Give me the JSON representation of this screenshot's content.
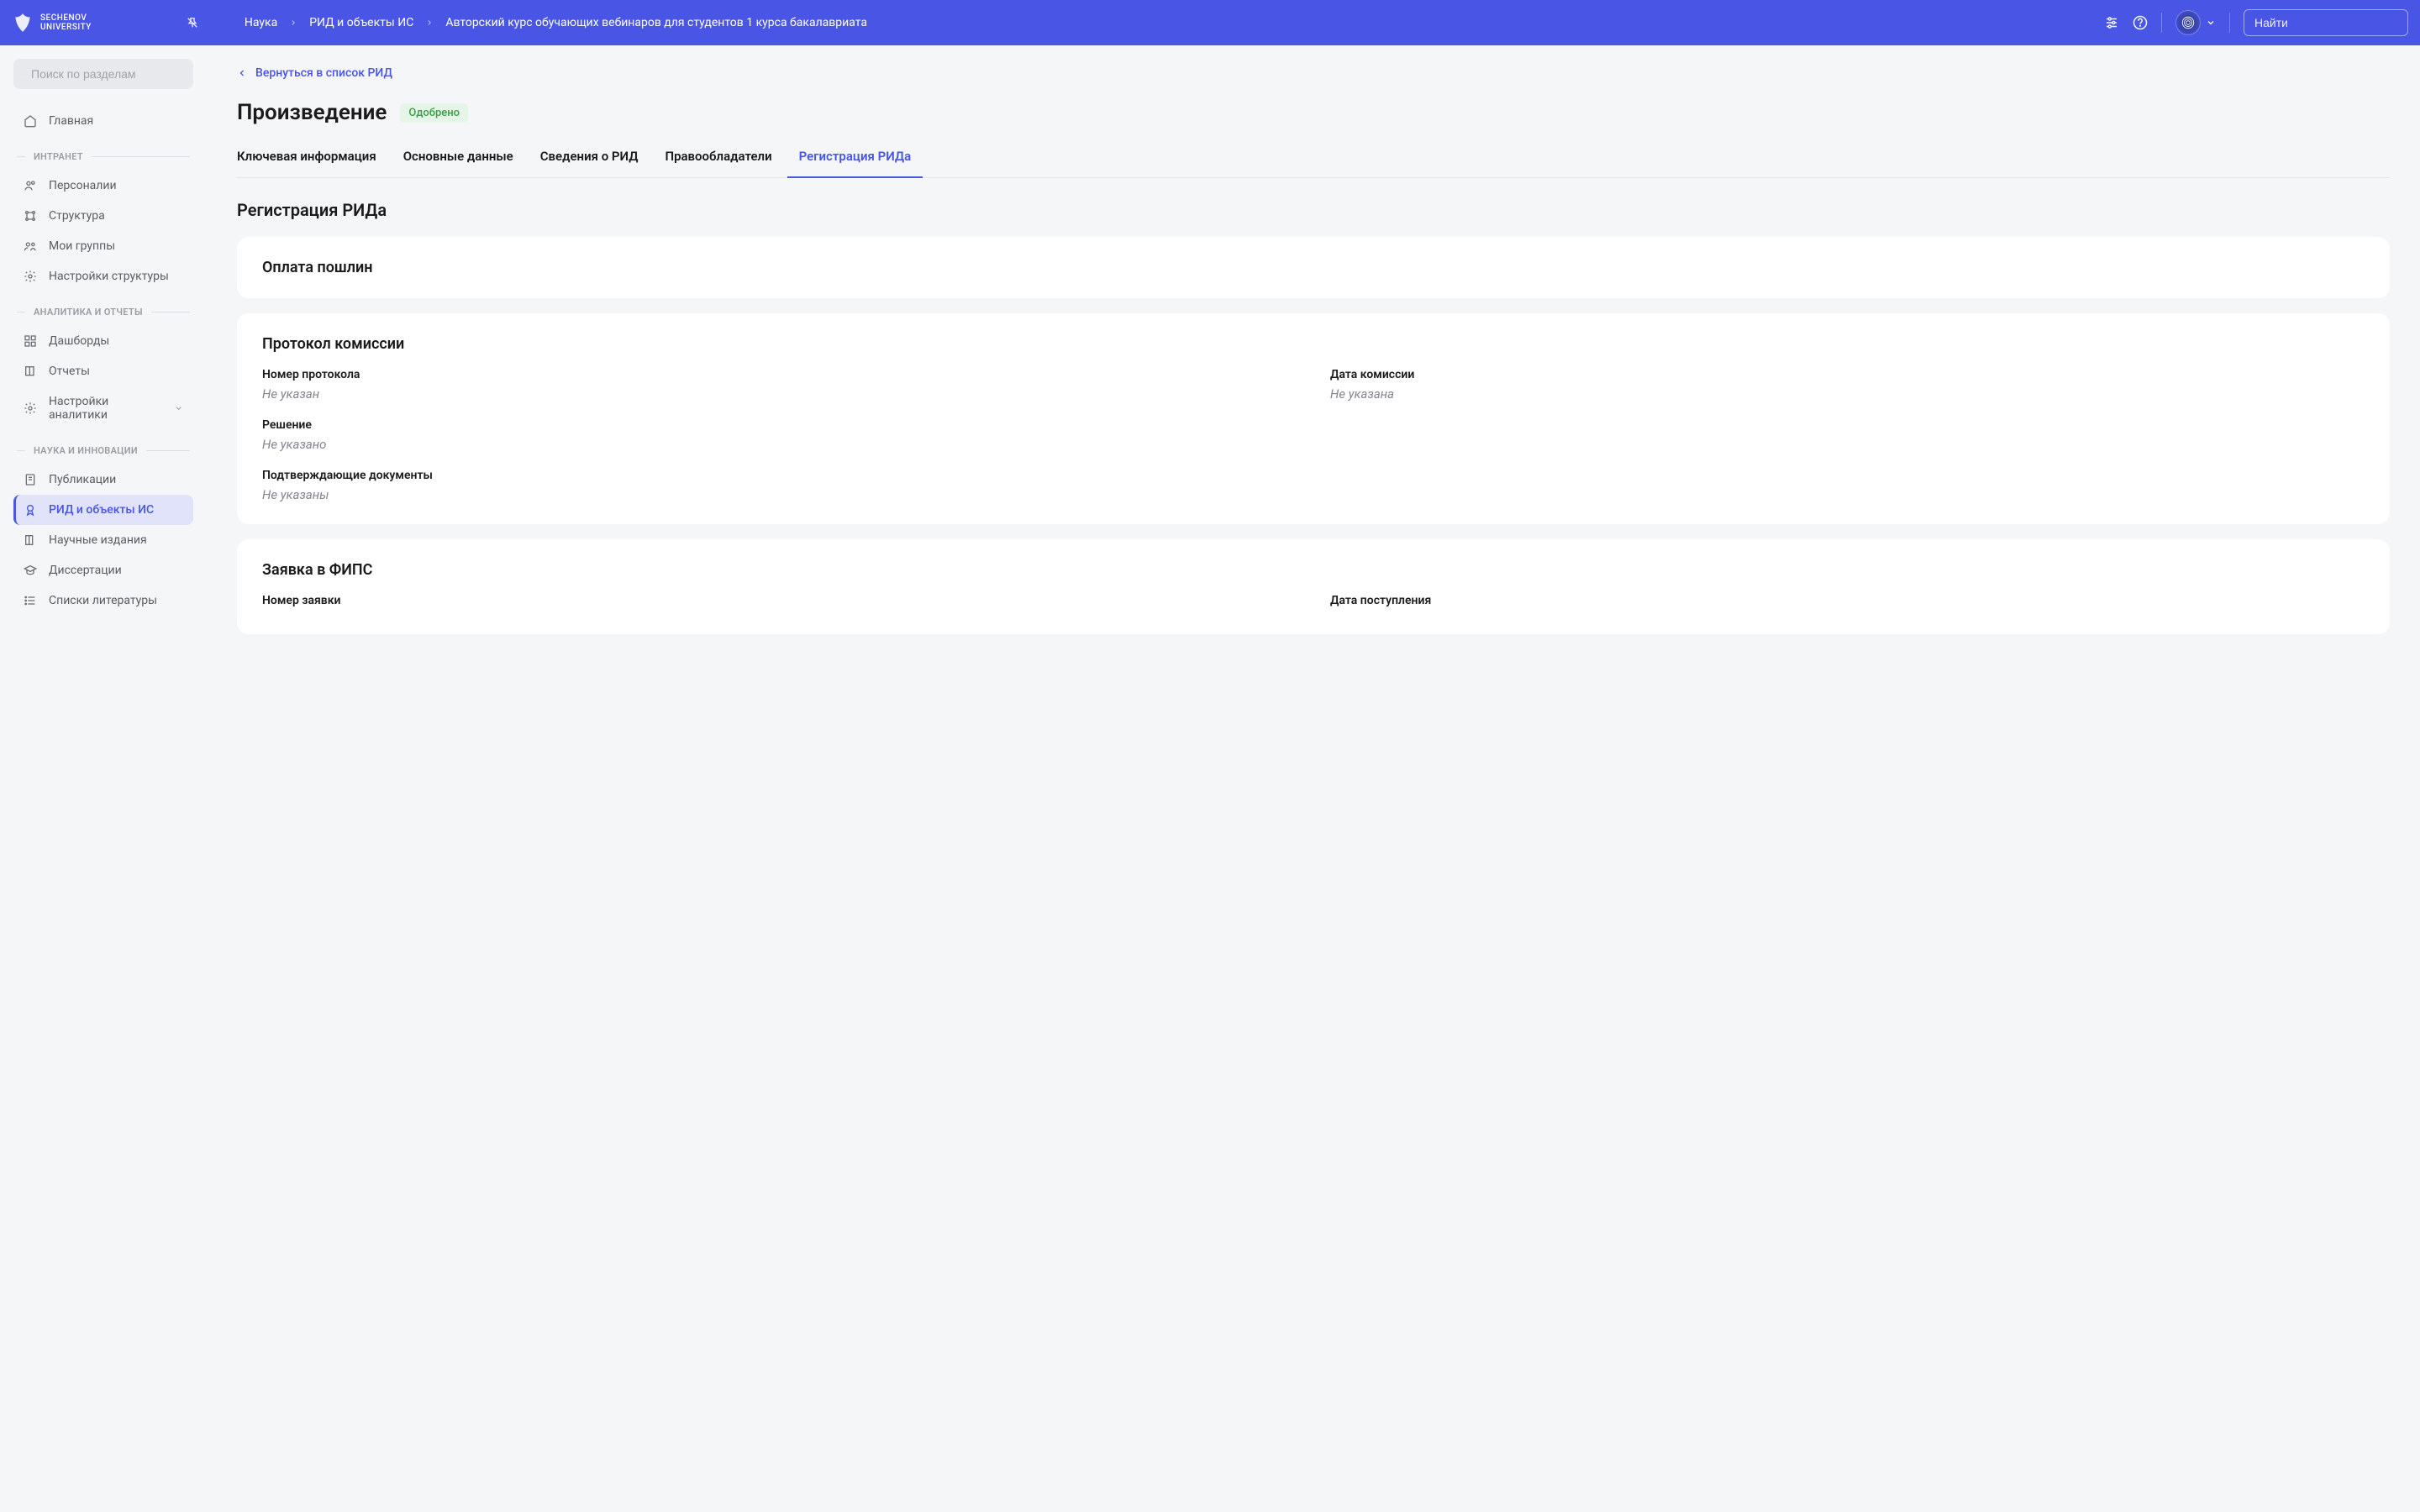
{
  "header": {
    "logo_line1": "Sechenov",
    "logo_line2": "University",
    "breadcrumb": [
      "Наука",
      "РИД и объекты ИС",
      "Авторский курс обучающих вебинаров для студентов 1 курса бакалавриата"
    ],
    "search_placeholder": "Найти"
  },
  "sidebar": {
    "search_placeholder": "Поиск по разделам",
    "home": "Главная",
    "sections": [
      {
        "title": "ИНТРАНЕТ",
        "items": [
          "Персоналии",
          "Структура",
          "Мои группы",
          "Настройки структуры"
        ]
      },
      {
        "title": "АНАЛИТИКА И ОТЧЕТЫ",
        "items": [
          "Дашборды",
          "Отчеты",
          "Настройки аналитики"
        ]
      },
      {
        "title": "НАУКА И ИННОВАЦИИ",
        "items": [
          "Публикации",
          "РИД и объекты ИС",
          "Научные издания",
          "Диссертации",
          "Списки литературы"
        ]
      }
    ]
  },
  "main": {
    "back_link": "Вернуться в список РИД",
    "title": "Произведение",
    "status": "Одобрено",
    "tabs": [
      "Ключевая информация",
      "Основные данные",
      "Сведения о РИД",
      "Правообладатели",
      "Регистрация РИДа"
    ],
    "section_heading": "Регистрация РИДа",
    "cards": {
      "fees": {
        "title": "Оплата пошлин"
      },
      "protocol": {
        "title": "Протокол комиссии",
        "fields": {
          "number_label": "Номер протокола",
          "number_value": "Не указан",
          "date_label": "Дата комиссии",
          "date_value": "Не указана",
          "decision_label": "Решение",
          "decision_value": "Не указано",
          "docs_label": "Подтверждающие документы",
          "docs_value": "Не указаны"
        }
      },
      "fips": {
        "title": "Заявка в ФИПС",
        "fields": {
          "number_label": "Номер заявки",
          "date_label": "Дата поступления"
        }
      }
    }
  }
}
